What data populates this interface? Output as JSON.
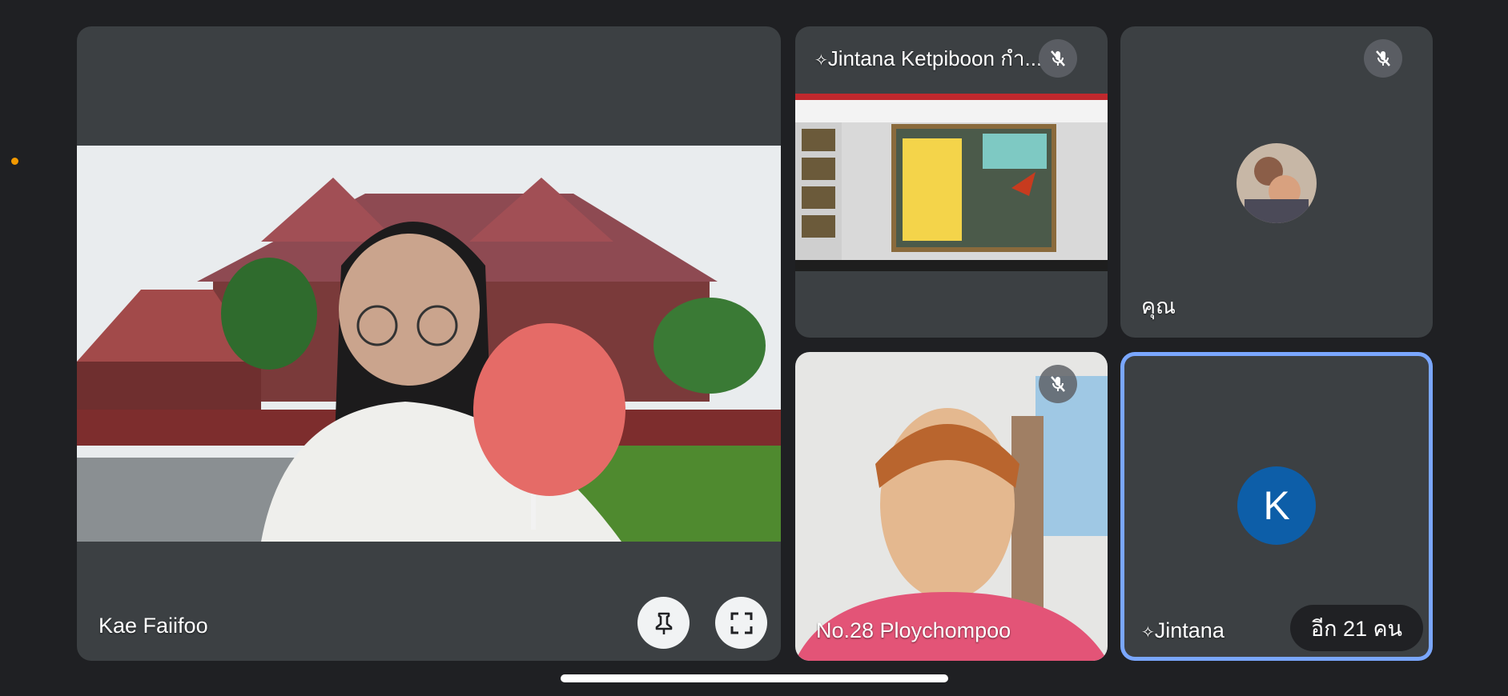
{
  "participants": {
    "main": {
      "name": "Kae Faiifoo"
    },
    "presenter": {
      "name": "Jintana Ketpiboon กำ...",
      "muted": true
    },
    "self": {
      "name": "คุณ",
      "muted": true
    },
    "student": {
      "name": "No.28 Ploychompoo",
      "muted": true
    },
    "host": {
      "name": "Jintana",
      "avatar_letter": "K"
    }
  },
  "overflow": {
    "label": "อีก 21 คน"
  },
  "icons": [
    "mic-off-icon",
    "pin-icon",
    "fullscreen-icon",
    "sparkle-icon"
  ],
  "colors": {
    "tile": "#3c4043",
    "background": "#1f2023",
    "active_border": "#7aa7ff",
    "avatar_k": "#0d5ea8",
    "indicator_dot": "#f29900"
  }
}
